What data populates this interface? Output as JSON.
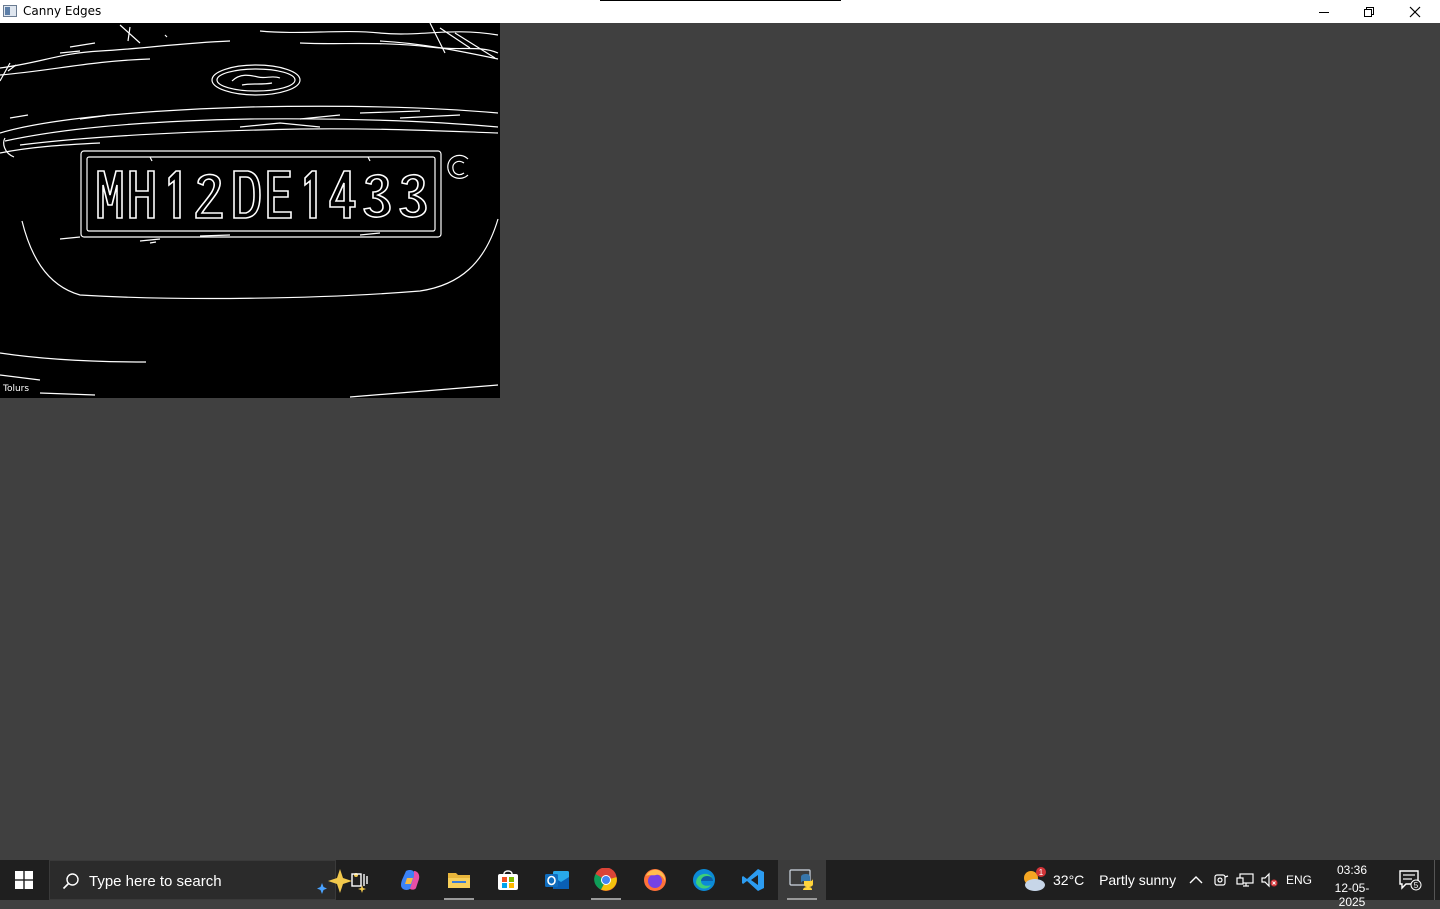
{
  "window": {
    "title": "Canny Edges"
  },
  "image": {
    "plate_text": "MH12DE1433",
    "logo_text": "Ford",
    "corner_text": "Tolurs"
  },
  "taskbar": {
    "search_placeholder": "Type here to search",
    "apps": [
      {
        "name": "task-view"
      },
      {
        "name": "copilot"
      },
      {
        "name": "file-explorer"
      },
      {
        "name": "microsoft-store"
      },
      {
        "name": "outlook"
      },
      {
        "name": "chrome"
      },
      {
        "name": "firefox"
      },
      {
        "name": "edge"
      },
      {
        "name": "vscode"
      },
      {
        "name": "python"
      }
    ],
    "weather": {
      "temp": "32°C",
      "condition": "Partly sunny",
      "badge": "1"
    },
    "tray": {
      "language": "ENG",
      "time": "03:36",
      "date": "12-05-2025",
      "notification_count": "5"
    }
  }
}
